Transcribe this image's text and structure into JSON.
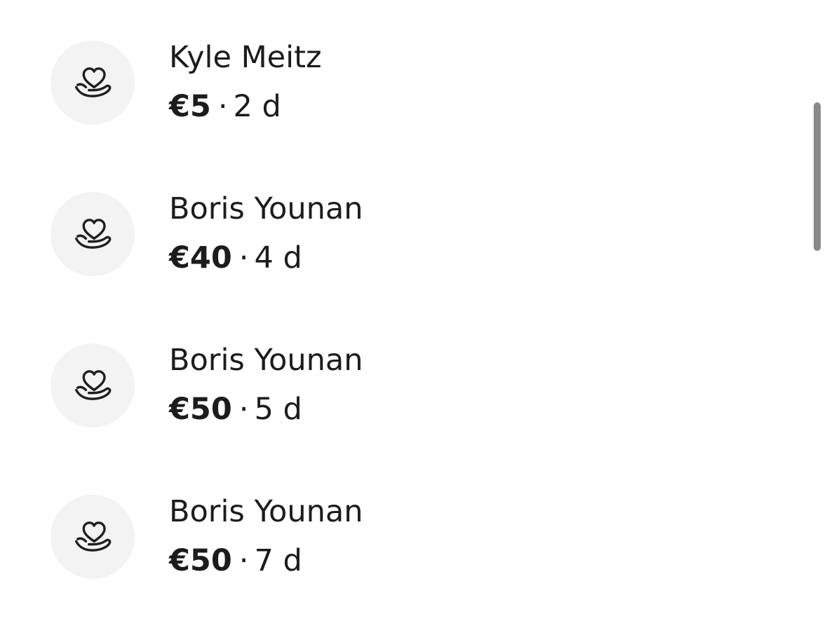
{
  "donations": [
    {
      "name": "Kyle Meitz",
      "amount": "€5",
      "separator": "·",
      "age": "2 d",
      "icon": "heart-hand-icon"
    },
    {
      "name": "Boris Younan",
      "amount": "€40",
      "separator": "·",
      "age": "4 d",
      "icon": "heart-hand-icon"
    },
    {
      "name": "Boris Younan",
      "amount": "€50",
      "separator": "·",
      "age": "5 d",
      "icon": "heart-hand-icon"
    },
    {
      "name": "Boris Younan",
      "amount": "€50",
      "separator": "·",
      "age": "7 d",
      "icon": "heart-hand-icon"
    }
  ],
  "colors": {
    "text": "#1c1c1c",
    "avatar_background": "#f3f3f3",
    "scrollbar": "#8a8a8a"
  }
}
